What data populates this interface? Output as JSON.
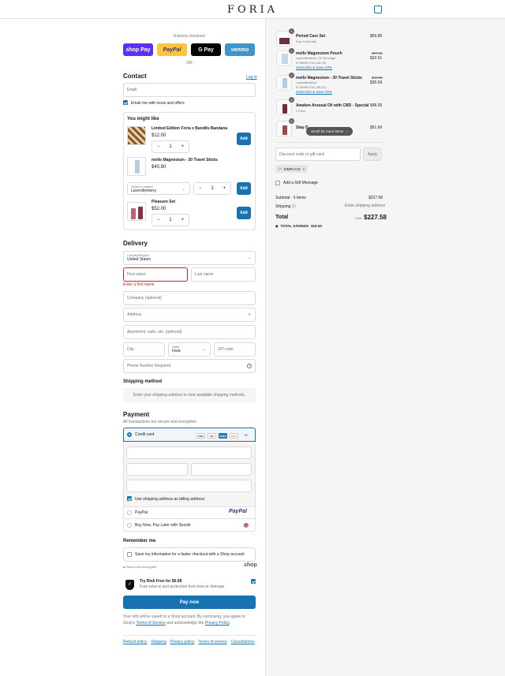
{
  "brand": {
    "logo": "FORIA"
  },
  "express": {
    "title": "Express checkout",
    "buttons": [
      {
        "label": "shop Pay",
        "bg": "#5a31f4",
        "fg": "#ffffff"
      },
      {
        "label": "PayPal",
        "bg": "#ffc439",
        "fg": "#253b80"
      },
      {
        "label": "G Pay",
        "bg": "#000000",
        "fg": "#ffffff"
      },
      {
        "label": "venmo",
        "bg": "#3d95ce",
        "fg": "#ffffff"
      }
    ],
    "or": "OR"
  },
  "contact": {
    "title": "Contact",
    "login": "Log in",
    "email_placeholder": "Email",
    "news_label": "Email me with news and offers"
  },
  "upsell": {
    "title": "You might like",
    "items": [
      {
        "name": "Limited Edition Foria x Bandits Bandana",
        "price": "$12.00",
        "qty": "1",
        "add": "Add"
      },
      {
        "name": "mello Magnesium - 30 Travel Sticks",
        "price": "$40.80",
        "variant_label": "Select a variant",
        "variant": "Lavenderberry",
        "qty": "1",
        "add": "Add"
      },
      {
        "name": "Pleasure Set",
        "price": "$52.00",
        "qty": "1",
        "add": "Add"
      }
    ]
  },
  "delivery": {
    "title": "Delivery",
    "country_label": "Country/Region",
    "country": "United States",
    "first_name": "First name",
    "first_name_error": "Enter a first name",
    "last_name": "Last name",
    "company": "Company (optional)",
    "address": "Address",
    "apartment": "Apartment, suite, etc. (optional)",
    "city": "City",
    "state_label": "State",
    "state": "Iowa",
    "zip": "ZIP code",
    "phone": "Phone Number Required"
  },
  "shipping": {
    "title": "Shipping method",
    "message": "Enter your shipping address to view available shipping methods."
  },
  "payment": {
    "title": "Payment",
    "subtitle": "All transactions are secure and encrypted.",
    "credit_card": "Credit card",
    "card_brands": [
      "VISA",
      "MC",
      "AMEX",
      "DISC"
    ],
    "more_cards": "+5",
    "billing_same": "Use shipping address as billing address",
    "paypal": "PayPal",
    "paypal_logo": "PayPal",
    "sezzle": "Buy Now, Pay Later with Sezzle"
  },
  "remember": {
    "title": "Remember me",
    "save_label": "Save my information for a faster checkout with a Shop account",
    "secure": "Secure and encrypted",
    "shop_logo": "shop"
  },
  "protection": {
    "title": "Try Risk Free for $0.98",
    "subtitle": "Free returns and protection from loss or damage"
  },
  "pay_button": "Pay now",
  "legal": {
    "text1": "Your info will be saved to a Shop account. By continuing, you agree to Shop's",
    "terms": "Terms of Service",
    "and": "and acknowledge the",
    "privacy": "Privacy Policy",
    "period": "."
  },
  "footer_links": [
    "Refund policy",
    "Shipping",
    "Privacy policy",
    "Terms of service",
    "Cancellations"
  ],
  "cart": {
    "items": [
      {
        "name": "Period Care Set",
        "variant": "Non-Coformity",
        "price": "$59.80",
        "qty": "1"
      },
      {
        "name": "mello Magnesium Pouch",
        "variant": "Lavenderberry / 30 Servings",
        "discount": "SIMPLY10 (-$4.76)",
        "subscribe": "Subscribe & Save 20%",
        "old_price": "$37.40",
        "price": "$32.61",
        "qty": "1"
      },
      {
        "name": "mello Magnesium - 30 Travel Sticks",
        "variant": "Lavenderberry",
        "discount": "SIMPLY10 (-$5.21)",
        "subscribe": "Subscribe & Save 20%",
        "old_price": "$40.80",
        "price": "$35.59",
        "qty": "1"
      },
      {
        "name": "Awaken Arousal Oil with CBD - Special",
        "variant": "1 Pack",
        "price": "$48.00",
        "qty": "1"
      },
      {
        "name": "Stay D",
        "price": "$51.60",
        "qty": "2"
      }
    ],
    "scroll_hint": "Scroll for more items",
    "discount_placeholder": "Discount code or gift card",
    "apply": "Apply",
    "code_tag": "SIMPLY10",
    "gift_message": "Add a Gift Message",
    "subtotal_label": "Subtotal · 6 items",
    "subtotal": "$227.58",
    "shipping_label": "Shipping",
    "shipping_value": "Enter shipping address",
    "total_label": "Total",
    "currency": "USD",
    "total": "$227.58",
    "savings_label": "TOTAL SAVINGS",
    "savings": "$10.00"
  },
  "colors": {
    "accent": "#1773b0",
    "error": "#dd1d1d"
  }
}
